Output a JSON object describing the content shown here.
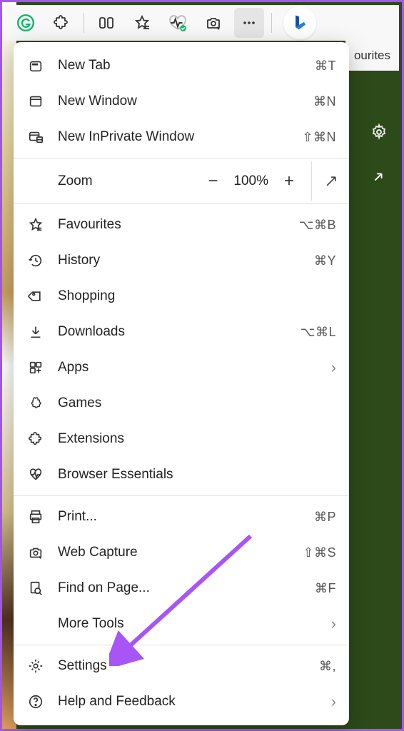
{
  "favbar": {
    "label": "ourites"
  },
  "menu": {
    "newTab": {
      "label": "New Tab",
      "shortcut": "⌘T"
    },
    "newWindow": {
      "label": "New Window",
      "shortcut": "⌘N"
    },
    "newPrivate": {
      "label": "New InPrivate Window",
      "shortcut": "⇧⌘N"
    },
    "zoom": {
      "label": "Zoom",
      "value": "100%"
    },
    "favourites": {
      "label": "Favourites",
      "shortcut": "⌥⌘B"
    },
    "history": {
      "label": "History",
      "shortcut": "⌘Y"
    },
    "shopping": {
      "label": "Shopping"
    },
    "downloads": {
      "label": "Downloads",
      "shortcut": "⌥⌘L"
    },
    "apps": {
      "label": "Apps"
    },
    "games": {
      "label": "Games"
    },
    "extensions": {
      "label": "Extensions"
    },
    "essentials": {
      "label": "Browser Essentials"
    },
    "print": {
      "label": "Print...",
      "shortcut": "⌘P"
    },
    "webCapture": {
      "label": "Web Capture",
      "shortcut": "⇧⌘S"
    },
    "findOnPage": {
      "label": "Find on Page...",
      "shortcut": "⌘F"
    },
    "moreTools": {
      "label": "More Tools"
    },
    "settings": {
      "label": "Settings",
      "shortcut": "⌘,"
    },
    "help": {
      "label": "Help and Feedback"
    }
  }
}
